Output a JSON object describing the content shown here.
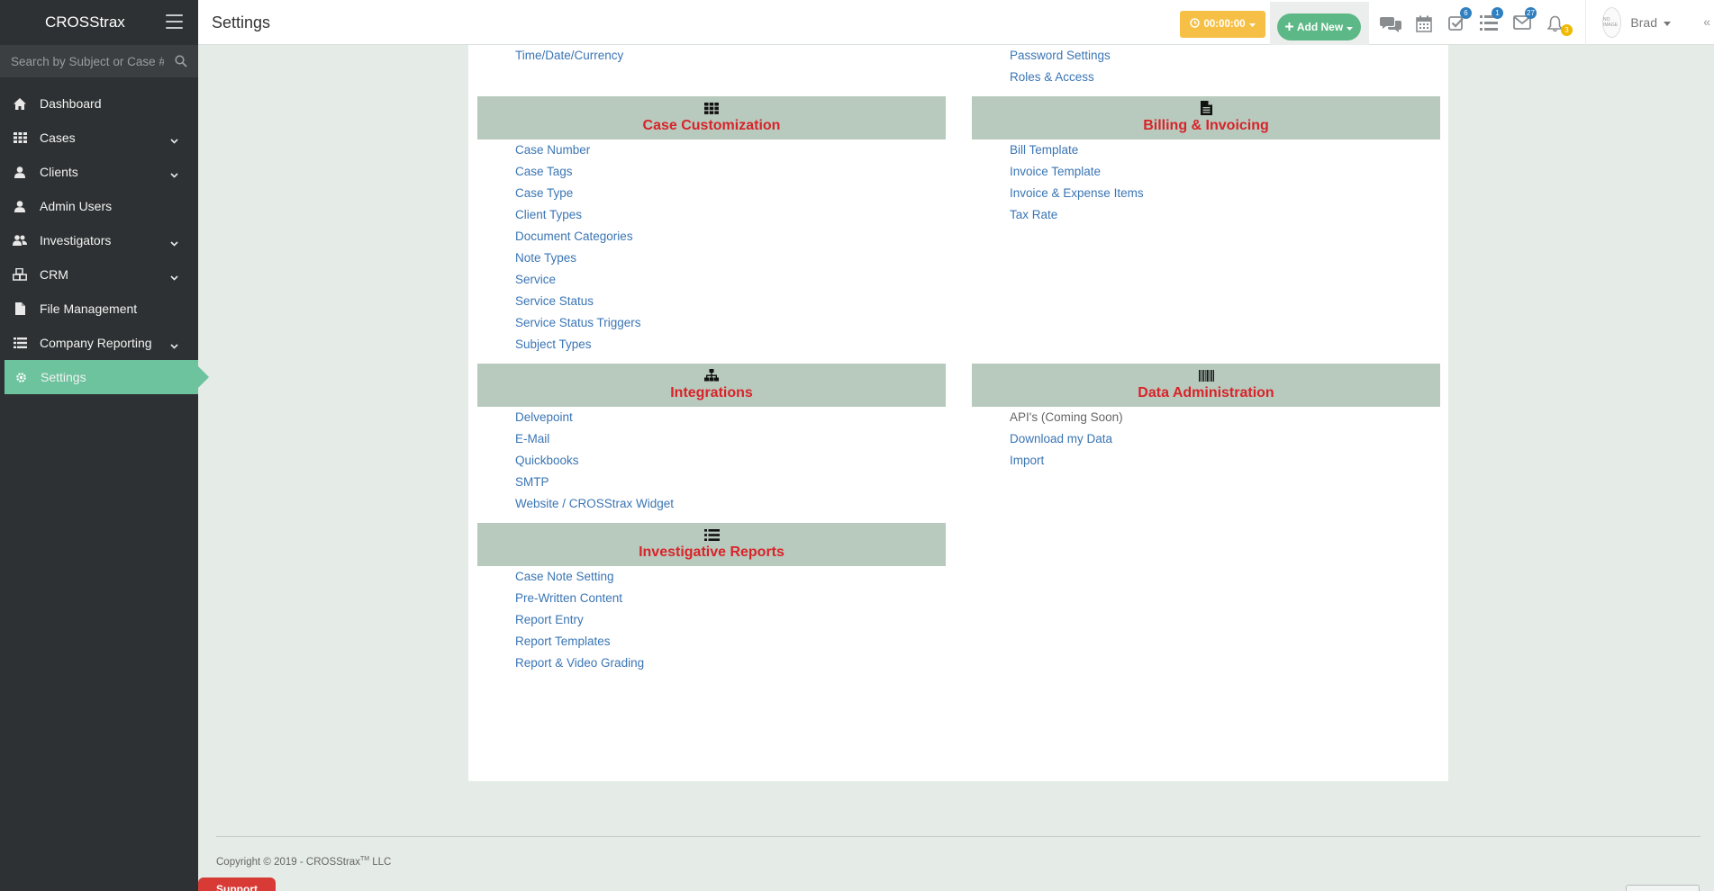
{
  "app": {
    "brand": "CROSStrax",
    "page_title": "Settings"
  },
  "sidebar": {
    "search_placeholder": "Search by Subject or Case #",
    "items": [
      {
        "label": "Dashboard",
        "icon": "home-icon"
      },
      {
        "label": "Cases",
        "icon": "grid-icon",
        "has_submenu": true
      },
      {
        "label": "Clients",
        "icon": "user-icon",
        "has_submenu": true
      },
      {
        "label": "Admin Users",
        "icon": "user-icon"
      },
      {
        "label": "Investigators",
        "icon": "users-icon",
        "has_submenu": true
      },
      {
        "label": "CRM",
        "icon": "cubes-icon",
        "has_submenu": true
      },
      {
        "label": "File Management",
        "icon": "file-icon"
      },
      {
        "label": "Company Reporting",
        "icon": "list-icon",
        "has_submenu": true
      },
      {
        "label": "Settings",
        "icon": "gear-icon",
        "active": true
      }
    ]
  },
  "topbar": {
    "timer": "00:00:00",
    "add_new": "Add New",
    "badges": {
      "tasks": "6",
      "list": "1",
      "mail": "27",
      "bell": "3"
    },
    "user": {
      "name": "Brad",
      "avatar_text": "NO IMAGE"
    }
  },
  "sections": {
    "top_left_links": [
      "Time/Date/Currency"
    ],
    "top_right_links": [
      "Password Settings",
      "Roles & Access"
    ],
    "case_customization": {
      "title": "Case Customization",
      "links": [
        "Case Number",
        "Case Tags",
        "Case Type",
        "Client Types",
        "Document Categories",
        "Note Types",
        "Service",
        "Service Status",
        "Service Status Triggers",
        "Subject Types"
      ]
    },
    "billing": {
      "title": "Billing & Invoicing",
      "links": [
        "Bill Template",
        "Invoice Template",
        "Invoice & Expense Items",
        "Tax Rate"
      ]
    },
    "integrations": {
      "title": "Integrations",
      "links": [
        "Delvepoint",
        "E-Mail",
        "Quickbooks",
        "SMTP",
        "Website / CROSStrax Widget"
      ]
    },
    "data_admin": {
      "title": "Data Administration",
      "plain_item": "API's (Coming Soon)",
      "links": [
        "Download my Data",
        "Import"
      ]
    },
    "investigative_reports": {
      "title": "Investigative Reports",
      "links": [
        "Case Note Setting",
        "Pre-Written Content",
        "Report Entry",
        "Report Templates",
        "Report & Video Grading"
      ]
    }
  },
  "footer": {
    "copyright_prefix": "Copyright © 2019 - CROSStrax",
    "copyright_tm": "TM",
    "copyright_suffix": " LLC",
    "support": "Support"
  },
  "colors": {
    "sidebar_bg": "#2e3133",
    "active_green": "#6cc39d",
    "section_header_bg": "#b8cabd",
    "section_title_red": "#d8232a",
    "link_blue": "#3a75b4",
    "timer_yellow": "#f6c046",
    "add_new_green": "#5cb886",
    "support_red": "#d83a35"
  }
}
